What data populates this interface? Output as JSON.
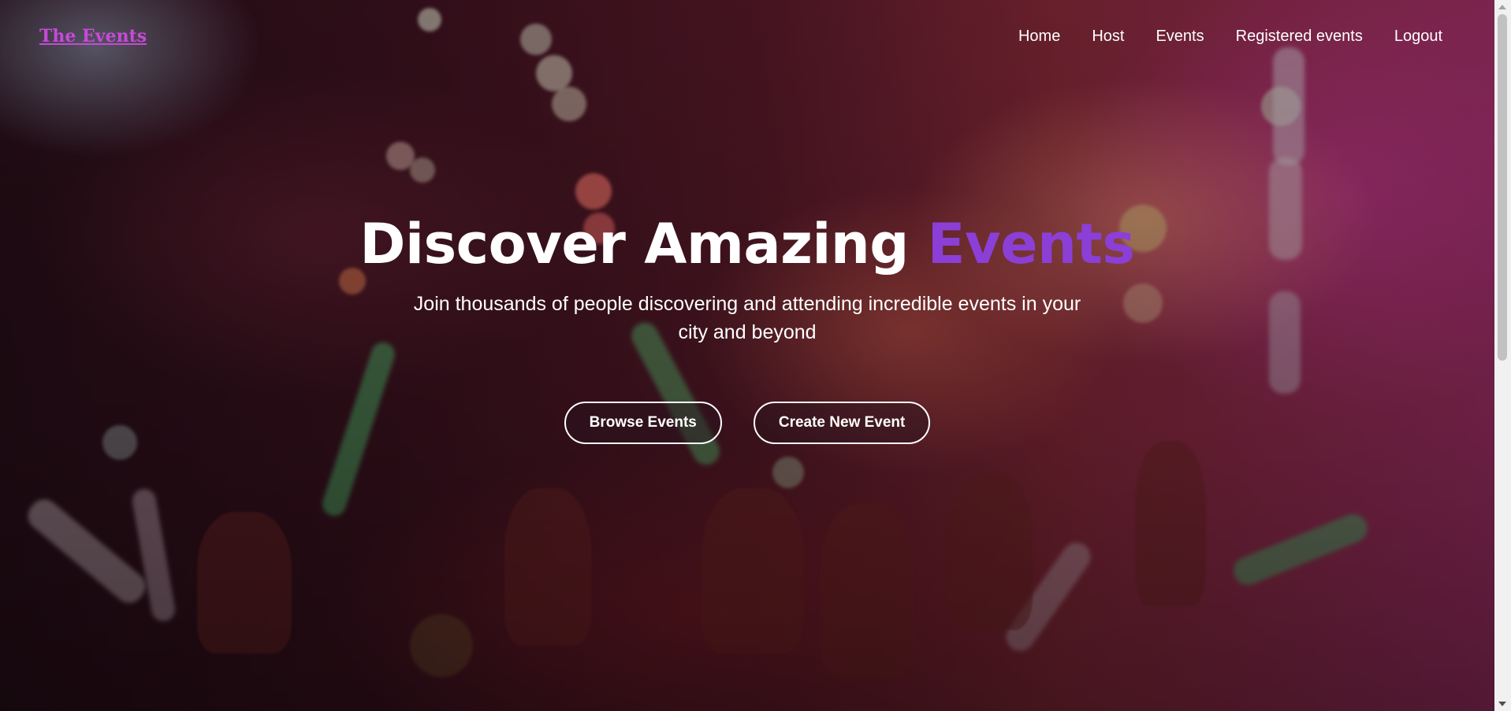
{
  "header": {
    "brand": "The Events",
    "nav": [
      {
        "label": "Home"
      },
      {
        "label": "Host"
      },
      {
        "label": "Events"
      },
      {
        "label": "Registered events"
      },
      {
        "label": "Logout"
      }
    ]
  },
  "hero": {
    "title_main": "Discover Amazing",
    "title_accent": "Events",
    "subtitle": "Join thousands of people discovering and attending incredible events in your city and beyond",
    "buttons": {
      "browse": "Browse Events",
      "create": "Create New Event"
    }
  },
  "colors": {
    "brand": "#c64ad8",
    "accent": "#8b3fd6",
    "text": "#ffffff"
  }
}
